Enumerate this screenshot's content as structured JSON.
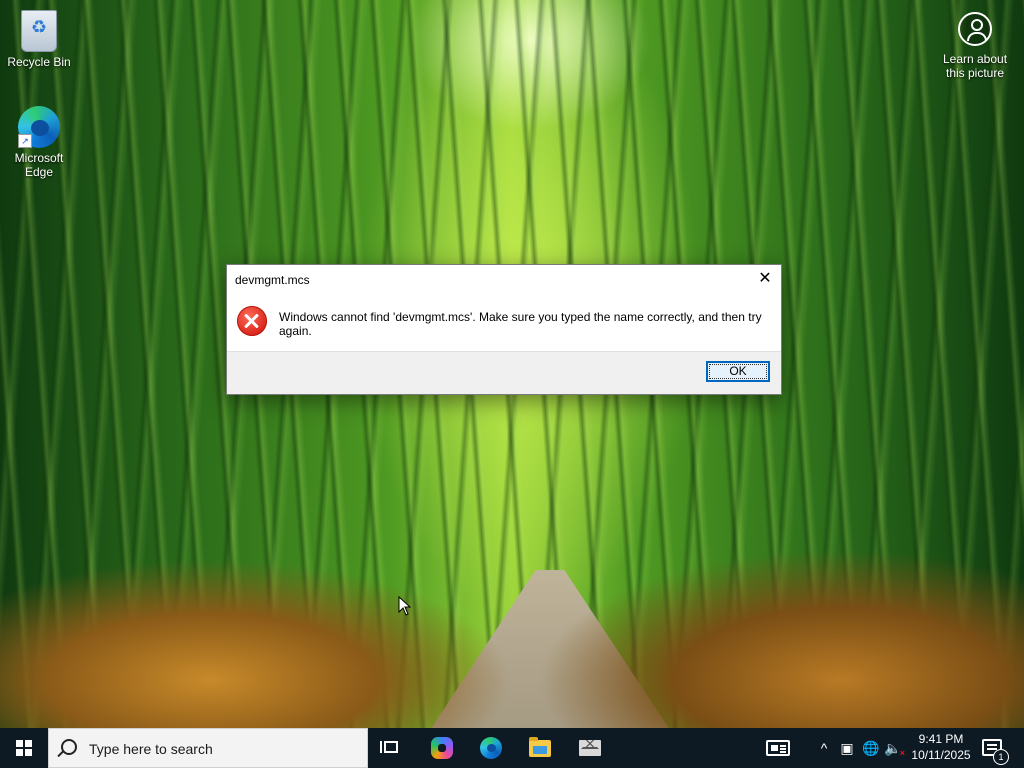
{
  "desktop": {
    "icons": [
      {
        "label": "Recycle Bin",
        "icon": "recycle-bin-icon"
      },
      {
        "label": "Microsoft Edge",
        "icon": "edge-icon"
      }
    ],
    "learn_about": {
      "label": "Learn about this picture",
      "icon": "camera-icon"
    }
  },
  "dialog": {
    "title": "devmgmt.mcs",
    "message": "Windows cannot find 'devmgmt.mcs'. Make sure you typed the name correctly, and then try again.",
    "ok_label": "OK",
    "close_glyph": "✕",
    "error_icon_color": "#e81123"
  },
  "taskbar": {
    "search_placeholder": "Type here to search",
    "apps": [
      "task-view-icon",
      "copilot-icon",
      "edge-icon",
      "file-explorer-icon",
      "mail-icon"
    ],
    "tray": {
      "chevron": "^",
      "time": "9:41 PM",
      "date": "10/11/2025",
      "notification_count": "1"
    },
    "background": "#0d1a23"
  }
}
